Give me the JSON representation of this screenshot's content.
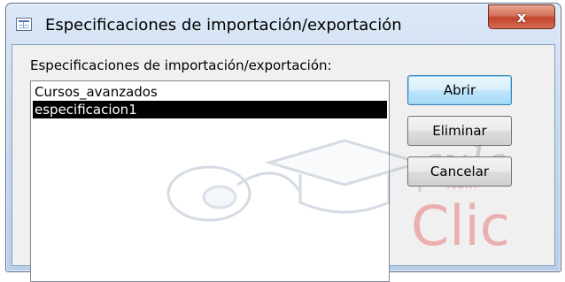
{
  "window": {
    "title": "Especificaciones de importación/exportación",
    "close_label": "x"
  },
  "list": {
    "label": "Especificaciones de importación/exportación:",
    "items": [
      {
        "label": "Cursos_avanzados",
        "selected": false
      },
      {
        "label": "especificacion1",
        "selected": true
      }
    ]
  },
  "buttons": {
    "open_label": "Abrir",
    "delete_label": "Eliminar",
    "cancel_label": "Cancelar"
  },
  "watermark": {
    "line1": "aula",
    "line2": "Clic",
    "suffix": ".com"
  },
  "icons": {
    "app": "table-icon",
    "close": "close-icon",
    "watermark": "mouse-graduation-cap-icon"
  },
  "colors": {
    "selection_bg": "#000000",
    "selection_fg": "#ffffff",
    "close_button": "#c2452d"
  }
}
